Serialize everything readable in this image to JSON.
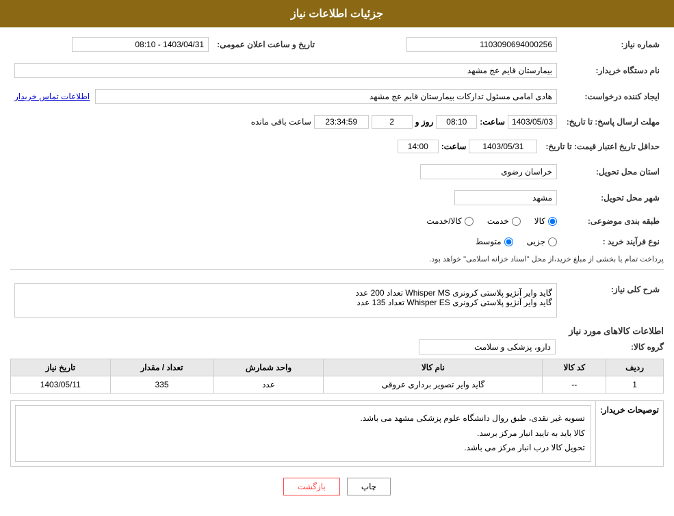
{
  "header": {
    "title": "جزئیات اطلاعات نیاز"
  },
  "fields": {
    "request_number_label": "شماره نیاز:",
    "request_number_value": "1103090694000256",
    "buyer_name_label": "نام دستگاه خریدار:",
    "buyer_name_value": "بیمارستان قایم  عج  مشهد",
    "creator_label": "ایجاد کننده درخواست:",
    "creator_value": "هادی امامی مسئول تدارکات بیمارستان قایم  عج  مشهد",
    "contact_link": "اطلاعات تماس خریدار",
    "send_deadline_label": "مهلت ارسال پاسخ: تا تاریخ:",
    "send_deadline_date": "1403/05/03",
    "send_deadline_time_label": "ساعت:",
    "send_deadline_time": "08:10",
    "send_deadline_days_label": "روز و",
    "send_deadline_days": "2",
    "send_deadline_remaining": "23:34:59",
    "send_deadline_remaining_label": "ساعت باقی مانده",
    "price_validity_label": "حداقل تاریخ اعتبار قیمت: تا تاریخ:",
    "price_validity_date": "1403/05/31",
    "price_validity_time_label": "ساعت:",
    "price_validity_time": "14:00",
    "province_label": "استان محل تحویل:",
    "province_value": "خراسان رضوی",
    "city_label": "شهر محل تحویل:",
    "city_value": "مشهد",
    "category_label": "طبقه بندی موضوعی:",
    "category_goods": "کالا",
    "category_service": "خدمت",
    "category_goods_service": "کالا/خدمت",
    "purchase_type_label": "نوع فرآیند خرید :",
    "purchase_type_minor": "جزیی",
    "purchase_type_medium": "متوسط",
    "purchase_notice": "پرداخت تمام یا بخشی از مبلغ خرید،از محل \"اسناد خزانه اسلامی\" خواهد بود.",
    "announcement_date_label": "تاریخ و ساعت اعلان عمومی:",
    "announcement_date_value": "1403/04/31 - 08:10"
  },
  "description_section": {
    "title": "شرح کلی نیاز:",
    "line1": "گاید وایر آنژیو پلاستی کرونری  Whisper MS  تعداد 200 عدد",
    "line2": "گاید وایر آنژیو پلاستی کرونری  Whisper ES  تعداد 135 عدد"
  },
  "goods_section": {
    "title": "اطلاعات کالاهای مورد نیاز",
    "group_label": "گروه کالا:",
    "group_value": "دارو، پزشکی و سلامت",
    "table": {
      "headers": [
        "ردیف",
        "کد کالا",
        "نام کالا",
        "واحد شمارش",
        "تعداد / مقدار",
        "تاریخ نیاز"
      ],
      "rows": [
        {
          "row_num": "1",
          "code": "--",
          "name": "گاید وایر تصویر برداری عروقی",
          "unit": "عدد",
          "quantity": "335",
          "date": "1403/05/11"
        }
      ]
    }
  },
  "buyer_notes": {
    "label": "توصیحات خریدار:",
    "line1": "تسویه غیر نقدی، طبق روال دانشگاه علوم پزشکی مشهد می باشد.",
    "line2": "کالا باید به تایید انبار مرکز برسد.",
    "line3": "تحویل کالا درب انبار مرکز می باشد."
  },
  "buttons": {
    "print": "چاپ",
    "back": "بازگشت"
  }
}
